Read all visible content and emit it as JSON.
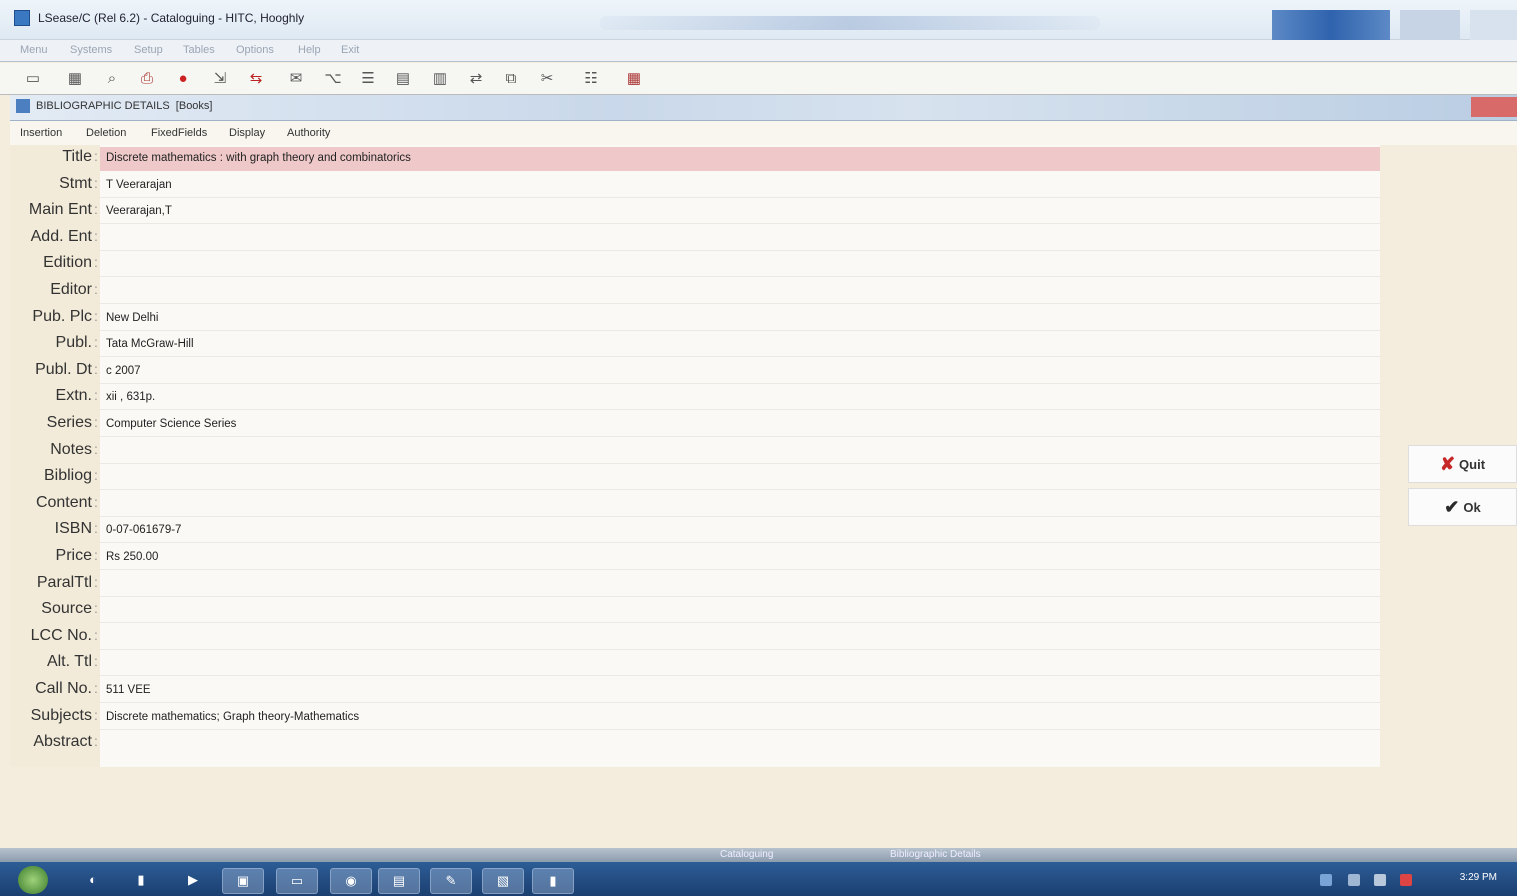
{
  "window": {
    "title": "LSease/C (Rel 6.2) - Cataloguing - HITC, Hooghly"
  },
  "menubar": [
    "Menu",
    "Systems",
    "Setup",
    "Tables",
    "Options",
    "Help",
    "Exit"
  ],
  "toolbar_icons": [
    "new-icon",
    "save-icon",
    "search-icon",
    "print-icon",
    "stop-icon",
    "import-icon",
    "export-icon",
    "report-icon",
    "tree-icon",
    "books-icon",
    "form-icon",
    "database-icon",
    "transfer-icon",
    "copy-icon",
    "tools-icon",
    "users-icon",
    "calendar-icon"
  ],
  "inner_window": {
    "title": "BIBLIOGRAPHIC DETAILS",
    "subtitle": "[Books]"
  },
  "submenu": [
    "Insertion",
    "Deletion",
    "FixedFields",
    "Display",
    "Authority"
  ],
  "fields": [
    {
      "label": "Title",
      "value": "Discrete mathematics : with graph theory and combinatorics"
    },
    {
      "label": "Stmt",
      "value": "T Veerarajan"
    },
    {
      "label": "Main Ent",
      "value": "Veerarajan,T"
    },
    {
      "label": "Add. Ent",
      "value": ""
    },
    {
      "label": "Edition",
      "value": ""
    },
    {
      "label": "Editor",
      "value": ""
    },
    {
      "label": "Pub. Plc",
      "value": "New Delhi"
    },
    {
      "label": "Publ.",
      "value": "Tata McGraw-Hill"
    },
    {
      "label": "Publ. Dt",
      "value": "c 2007"
    },
    {
      "label": "Extn.",
      "value": "xii , 631p."
    },
    {
      "label": "Series",
      "value": "Computer Science Series"
    },
    {
      "label": "Notes",
      "value": ""
    },
    {
      "label": "Bibliog",
      "value": ""
    },
    {
      "label": "Content",
      "value": ""
    },
    {
      "label": "ISBN",
      "value": "0-07-061679-7"
    },
    {
      "label": "Price",
      "value": "Rs 250.00"
    },
    {
      "label": "ParalTtl",
      "value": ""
    },
    {
      "label": "Source",
      "value": ""
    },
    {
      "label": "LCC No.",
      "value": ""
    },
    {
      "label": "Alt. Ttl",
      "value": ""
    },
    {
      "label": "Call No.",
      "value": "511 VEE"
    },
    {
      "label": "Subjects",
      "value": "Discrete mathematics; Graph theory-Mathematics"
    },
    {
      "label": "Abstract",
      "value": ""
    }
  ],
  "buttons": {
    "quit": "Quit",
    "ok": "Ok"
  },
  "statusbar": {
    "left": "Cataloguing",
    "right": "Bibliographic Details"
  },
  "taskbar": {
    "clock": "3:29 PM"
  },
  "colors": {
    "title_highlight": "#efc9c9",
    "label_bg": "#f2ebd9",
    "taskbar": "#2d5d97"
  }
}
